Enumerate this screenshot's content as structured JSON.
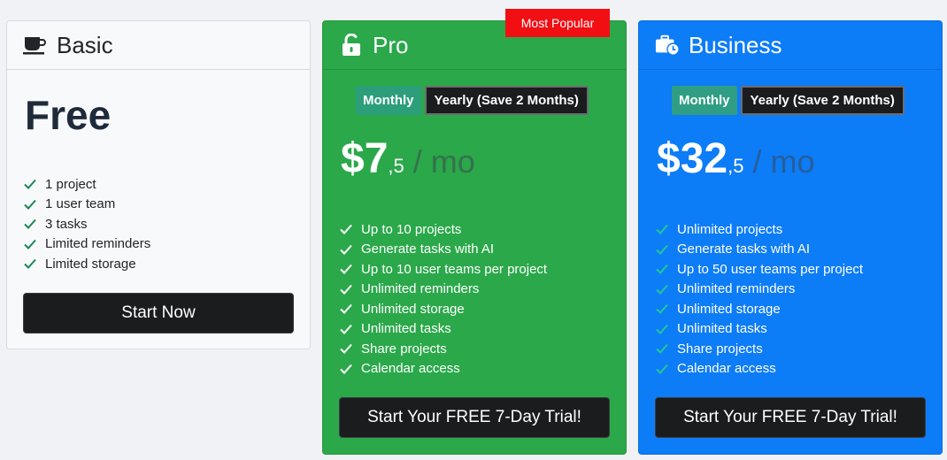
{
  "badge": "Most Popular",
  "basic": {
    "title": "Basic",
    "icon": "coffee-cup-icon",
    "price_label": "Free",
    "features": [
      "1 project",
      "1 user team",
      "3 tasks",
      "Limited reminders",
      "Limited storage"
    ],
    "button": "Start Now"
  },
  "pro": {
    "title": "Pro",
    "icon": "unlock-icon",
    "toggle_monthly": "Monthly",
    "toggle_yearly": "Yearly (Save 2 Months)",
    "price_amount": "$7",
    "price_cents": ",5",
    "price_period": "/ mo",
    "features": [
      "Up to 10 projects",
      "Generate tasks with AI",
      "Up to 10 user teams per project",
      "Unlimited reminders",
      "Unlimited storage",
      "Unlimited tasks",
      "Share projects",
      "Calendar access"
    ],
    "button": "Start Your FREE 7-Day Trial!"
  },
  "business": {
    "title": "Business",
    "icon": "briefcase-clock-icon",
    "toggle_monthly": "Monthly",
    "toggle_yearly": "Yearly (Save 2 Months)",
    "price_amount": "$32",
    "price_cents": ",5",
    "price_period": "/ mo",
    "features": [
      "Unlimited projects",
      "Generate tasks with AI",
      "Up to 50 user teams per project",
      "Unlimited reminders",
      "Unlimited storage",
      "Unlimited tasks",
      "Share projects",
      "Calendar access"
    ],
    "button": "Start Your FREE 7-Day Trial!"
  },
  "colors": {
    "pro_bg": "#2ba84a",
    "business_bg": "#0d7cf7",
    "badge_bg": "#f20f14",
    "check_basic": "#198754",
    "check_business": "#20c997"
  }
}
